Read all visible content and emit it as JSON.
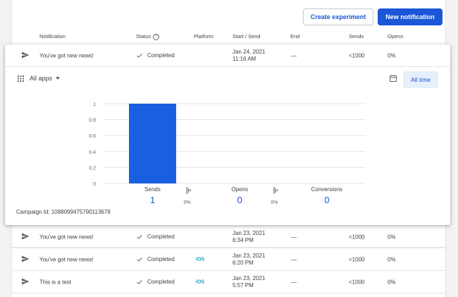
{
  "toolbar": {
    "create_experiment": "Create experiment",
    "new_notification": "New notification"
  },
  "columns": {
    "notification": "Notification",
    "status": "Status",
    "platform": "Platform",
    "start_send": "Start / Send",
    "end": "End",
    "sends": "Sends",
    "opens": "Opens"
  },
  "expanded_row": {
    "title": "You've got new news!",
    "status": "Completed",
    "platform": "",
    "date": "Jan 24, 2021",
    "time": "11:16 AM",
    "end": "—",
    "sends": "<1000",
    "opens": "0%"
  },
  "filters": {
    "apps_label": "All apps",
    "time_label": "All time"
  },
  "chart_data": {
    "type": "bar",
    "categories": [
      "Sends",
      "Opens",
      "Conversions"
    ],
    "values": [
      1,
      0,
      0
    ],
    "category_values": [
      "1",
      "0",
      "0"
    ],
    "rates": [
      "0%",
      "0%"
    ],
    "ylim": [
      0,
      1
    ],
    "yticks": [
      "0",
      "0.2",
      "0.4",
      "0.6",
      "0.8",
      "1"
    ],
    "grid": true,
    "bar_color": "#1a5fe0"
  },
  "campaign_id": "Campaign Id: 1088099475790113678",
  "rows": [
    {
      "title": "You've got new news!",
      "status": "Completed",
      "platform": "",
      "date": "Jan 23, 2021",
      "time": "6:34 PM",
      "end": "—",
      "sends": "<1000",
      "opens": "0%"
    },
    {
      "title": "You've got new news!",
      "status": "Completed",
      "platform": "iOS",
      "date": "Jan 23, 2021",
      "time": "6:20 PM",
      "end": "—",
      "sends": "<1000",
      "opens": "0%"
    },
    {
      "title": "This is a test",
      "status": "Completed",
      "platform": "iOS",
      "date": "Jan 23, 2021",
      "time": "5:57 PM",
      "end": "—",
      "sends": "<1000",
      "opens": "0%"
    }
  ],
  "colors": {
    "accent": "#1a56d6",
    "ios": "#1a96c8"
  }
}
